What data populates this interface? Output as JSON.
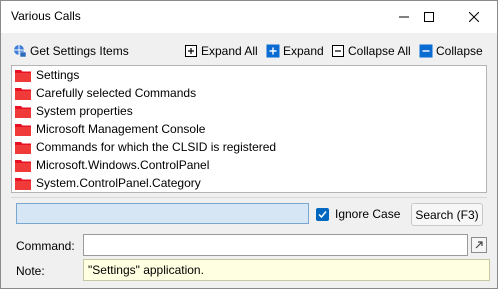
{
  "window": {
    "title": "Various Calls",
    "minimize_icon": "minimize-icon",
    "maximize_icon": "maximize-icon",
    "close_icon": "close-icon"
  },
  "toolbar": {
    "get_settings": "Get Settings Items",
    "expand_all": "Expand All",
    "expand": "Expand",
    "collapse_all": "Collapse All",
    "collapse": "Collapse"
  },
  "tree": {
    "items": [
      {
        "label": "Settings"
      },
      {
        "label": "Carefully selected Commands"
      },
      {
        "label": "System properties"
      },
      {
        "label": "Microsoft Management Console"
      },
      {
        "label": "Commands for which the CLSID is registered"
      },
      {
        "label": "Microsoft.Windows.ControlPanel"
      },
      {
        "label": "System.ControlPanel.Category"
      }
    ]
  },
  "search": {
    "value": "",
    "ignore_case_label": "Ignore Case",
    "ignore_case_checked": true,
    "button_label": "Search (F3)"
  },
  "command": {
    "label": "Command:",
    "value": ""
  },
  "note": {
    "label": "Note:",
    "value": "\"Settings\" application."
  },
  "colors": {
    "accent": "#0067c0",
    "folder": "#e81123",
    "note_bg": "#ffffe1",
    "search_bg": "#d6e6f5"
  }
}
